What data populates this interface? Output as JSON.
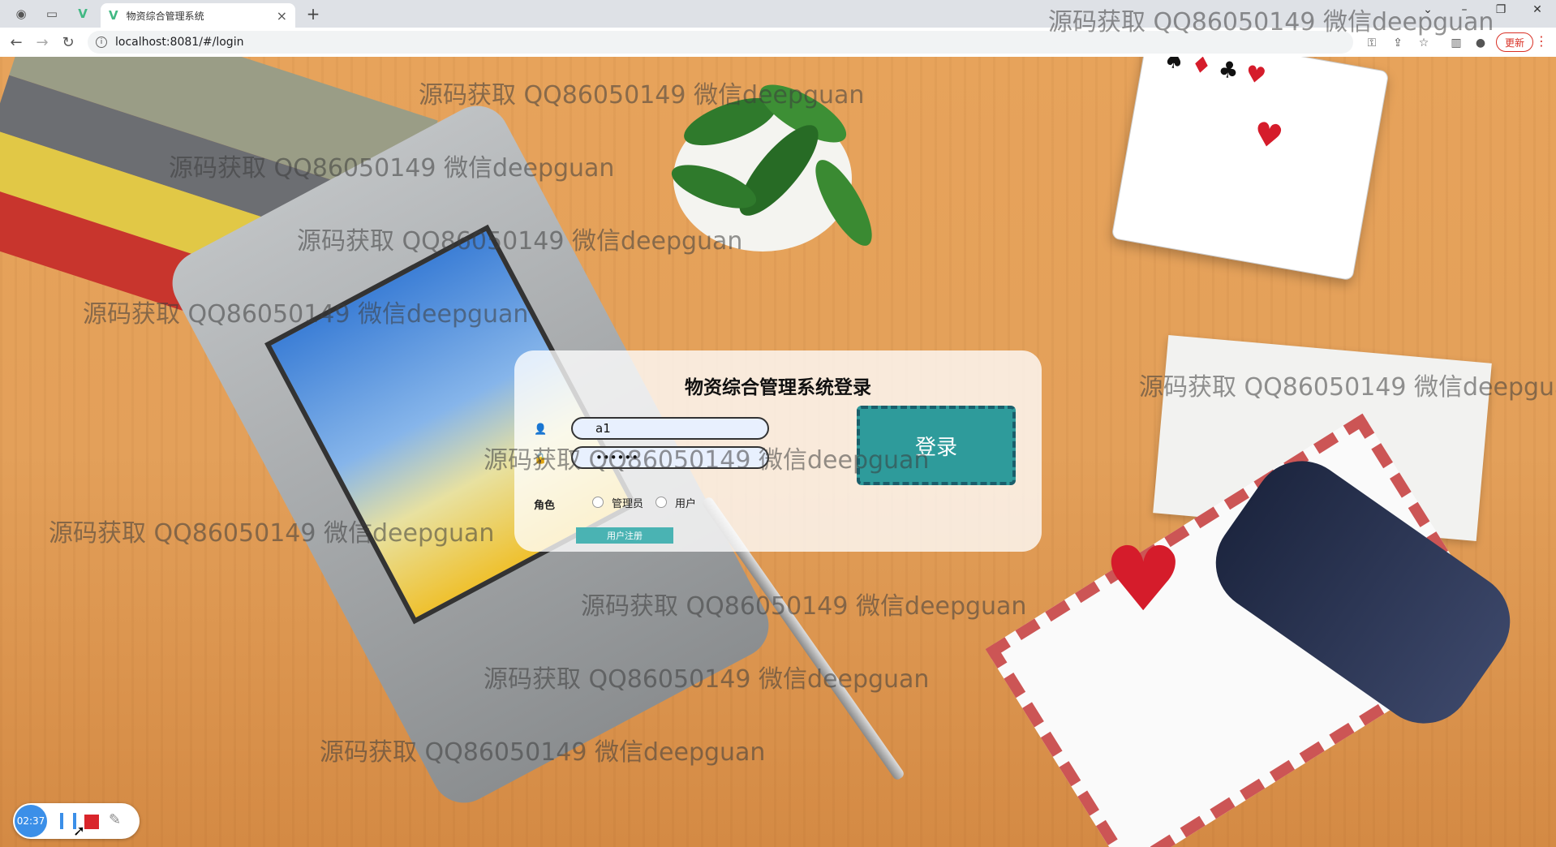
{
  "browser": {
    "tab_title": "物资综合管理系统",
    "url": "localhost:8081/#/login",
    "update_label": "更新",
    "new_tab_symbol": "+",
    "close_symbol": "×"
  },
  "login": {
    "title": "物资综合管理系统登录",
    "username_value": "a1",
    "password_value": "••••••",
    "role_label": "角色",
    "role_options": [
      "管理员",
      "用户"
    ],
    "register_label": "用户注册",
    "login_label": "登录"
  },
  "watermark": {
    "text": "源码获取 QQ86050149 微信deepguan",
    "text_truncated": "源码获取 QQ86050149 微信deepgua"
  },
  "recorder": {
    "timer": "02:37"
  }
}
